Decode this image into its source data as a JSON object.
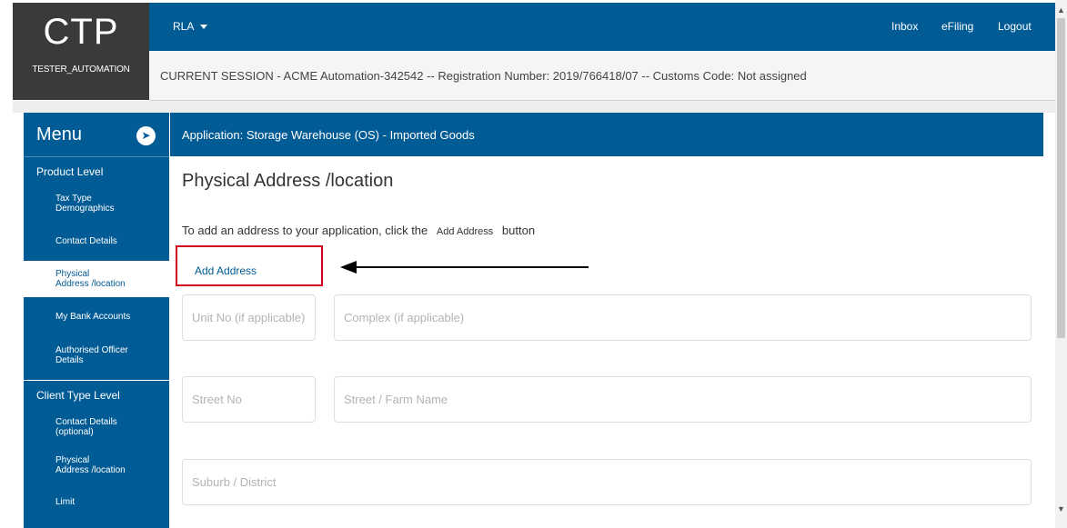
{
  "brand": {
    "logo": "CTP",
    "user": "TESTER_AUTOMATION"
  },
  "topbar": {
    "role_dropdown": "RLA",
    "links": {
      "inbox": "Inbox",
      "efiling": "eFiling",
      "logout": "Logout"
    }
  },
  "session": {
    "text": "CURRENT SESSION - ACME Automation-342542 -- Registration Number: 2019/766418/07 -- Customs Code: Not assigned"
  },
  "sidebar": {
    "title": "Menu",
    "toggle_icon": "pin-icon",
    "sections": {
      "product_level": {
        "label": "Product Level",
        "items": [
          "Tax Type\nDemographics",
          "Contact Details",
          "Physical\nAddress /location",
          "My Bank Accounts",
          "Authorised Officer\nDetails"
        ],
        "active_index": 2
      },
      "client_type_level": {
        "label": "Client Type Level",
        "items": [
          "Contact Details\n(optional)",
          "Physical\nAddress /location",
          "Limit"
        ]
      }
    }
  },
  "application": {
    "title": "Application: Storage Warehouse (OS) - Imported Goods"
  },
  "content": {
    "section_title": "Physical Address /location",
    "instructions": {
      "prefix": "To add an address to your application, click the",
      "button_ref": "Add Address",
      "suffix": "button"
    },
    "add_address_label": "Add Address",
    "fields": {
      "unit_no": {
        "placeholder": "Unit No (if applicable)",
        "value": ""
      },
      "complex": {
        "placeholder": "Complex (if applicable)",
        "value": ""
      },
      "street_no": {
        "placeholder": "Street No",
        "value": ""
      },
      "street_name": {
        "placeholder": "Street / Farm Name",
        "value": ""
      },
      "suburb": {
        "placeholder": "Suburb / District",
        "value": ""
      }
    }
  },
  "annotation": {
    "highlight_color": "#d0021b",
    "arrow_color": "#000000"
  },
  "colors": {
    "primary": "#015b95",
    "dark": "#3a3a3a"
  }
}
